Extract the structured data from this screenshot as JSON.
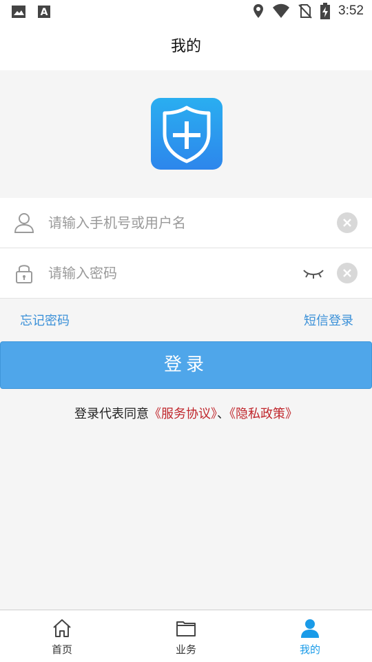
{
  "status_bar": {
    "time": "3:52",
    "icons": [
      "image-icon",
      "text-a-icon",
      "location-icon",
      "wifi-icon",
      "no-sim-icon",
      "battery-charging-icon"
    ]
  },
  "header": {
    "title": "我的"
  },
  "logo": {
    "icon": "shield-plus-icon",
    "colors": {
      "top": "#2aaef0",
      "bottom": "#2d86ec"
    }
  },
  "login_form": {
    "username": {
      "placeholder": "请输入手机号或用户名",
      "value": "",
      "icon": "user-icon"
    },
    "password": {
      "placeholder": "请输入密码",
      "value": "",
      "icon": "lock-icon",
      "toggle_icon": "eye-closed-icon"
    }
  },
  "links": {
    "forgot_password": "忘记密码",
    "sms_login": "短信登录"
  },
  "login_button": {
    "label": "登录"
  },
  "agreement": {
    "prefix": "登录代表同意",
    "service": "《服务协议》",
    "separator": "、",
    "privacy": "《隐私政策》"
  },
  "bottom_nav": {
    "items": [
      {
        "label": "首页",
        "icon": "home-icon",
        "active": false
      },
      {
        "label": "业务",
        "icon": "folder-icon",
        "active": false
      },
      {
        "label": "我的",
        "icon": "person-icon",
        "active": true
      }
    ],
    "active_color": "#1a9be8"
  },
  "accent_color": "#4fa6ea"
}
